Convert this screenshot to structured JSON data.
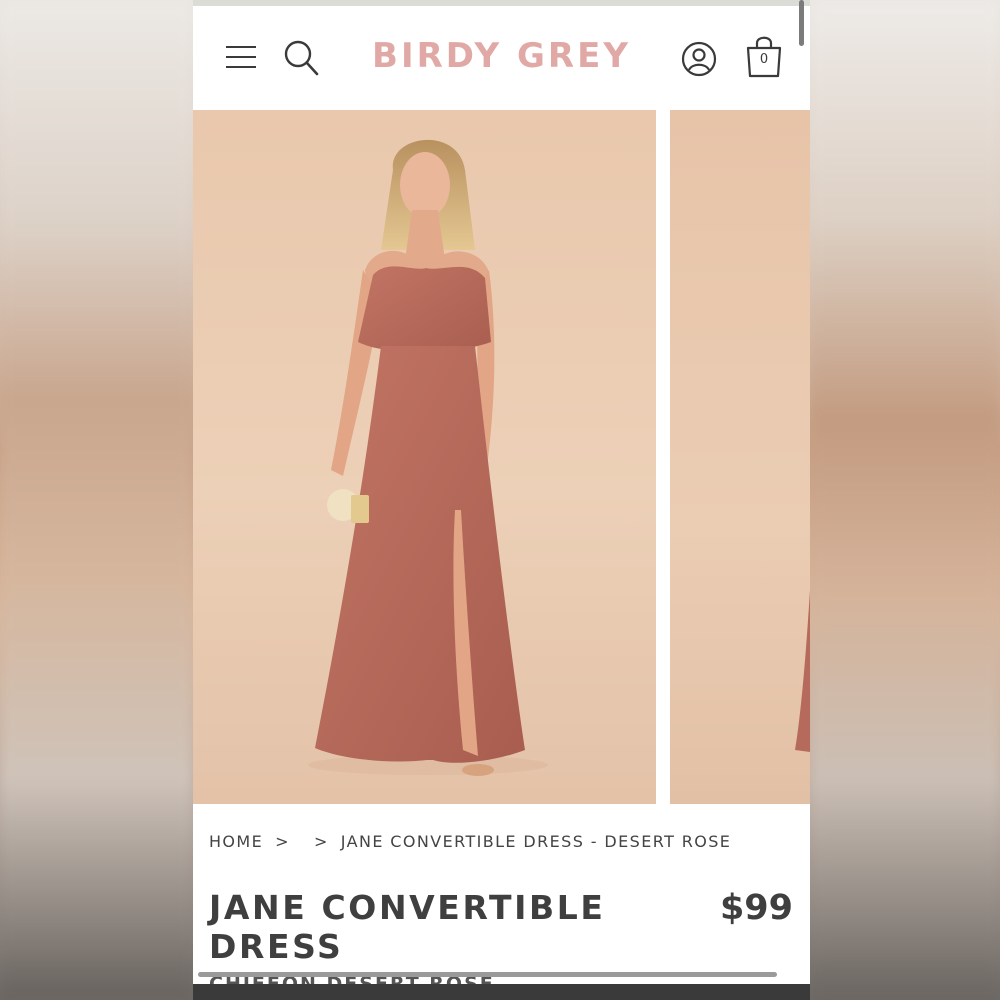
{
  "brand": {
    "logo_text": "BIRDY GREY",
    "logo_color": "#e0a9a6"
  },
  "header": {
    "menu_icon": "hamburger-menu-icon",
    "search_icon": "search-icon",
    "account_icon": "account-icon",
    "cart_icon": "shopping-bag-icon",
    "cart_count": "0"
  },
  "gallery": {
    "slides": [
      {
        "description": "model in desert rose convertible dress"
      },
      {
        "description": "next product image"
      }
    ]
  },
  "breadcrumb": {
    "items": [
      "HOME",
      "",
      "JANE CONVERTIBLE DRESS - DESERT ROSE"
    ],
    "separator": ">"
  },
  "product": {
    "title": "JANE CONVERTIBLE DRESS",
    "price": "$99",
    "subtitle": "CHIFFON DESERT ROSE"
  },
  "colors": {
    "dress": "#b96b5c",
    "backdrop": "#ecd0b7",
    "text": "#3f3f3f"
  }
}
